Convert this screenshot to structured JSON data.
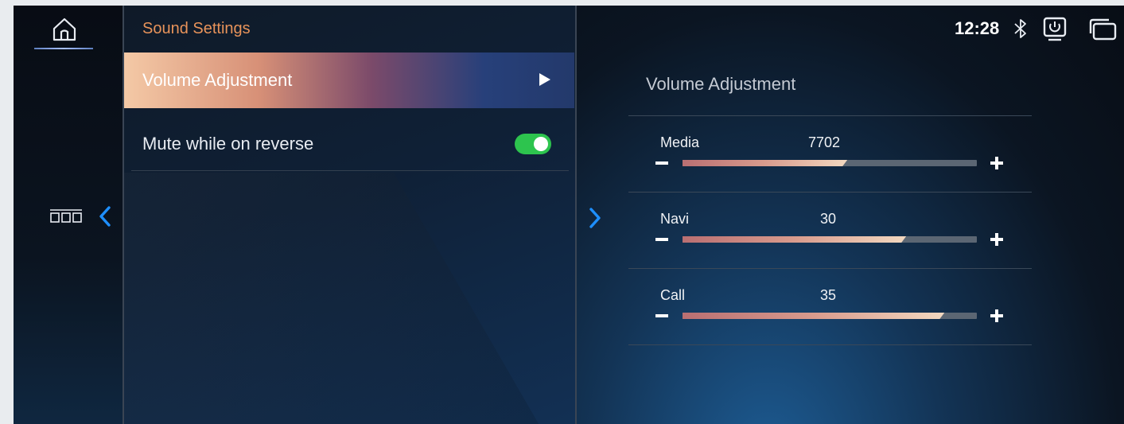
{
  "status": {
    "time": "12:28"
  },
  "menu": {
    "title": "Sound Settings",
    "items": [
      {
        "label": "Volume Adjustment",
        "selected": true
      },
      {
        "label": "Mute while on reverse",
        "toggle_on": true
      }
    ]
  },
  "volume": {
    "title": "Volume Adjustment",
    "rows": [
      {
        "name": "Media",
        "value": "7702",
        "level": 0.56
      },
      {
        "name": "Navi",
        "value": "30",
        "level": 0.76
      },
      {
        "name": "Call",
        "value": "35",
        "level": 0.89
      }
    ]
  },
  "colors": {
    "title_accent": "#e8935a",
    "toggle_on": "#2dc44e"
  },
  "icons": [
    "home-icon",
    "apps-grid-icon",
    "chevron-left-icon",
    "chevron-right-icon",
    "bluetooth-icon",
    "screen-mirror-icon",
    "window-icon",
    "back-icon",
    "play-arrow-icon"
  ]
}
